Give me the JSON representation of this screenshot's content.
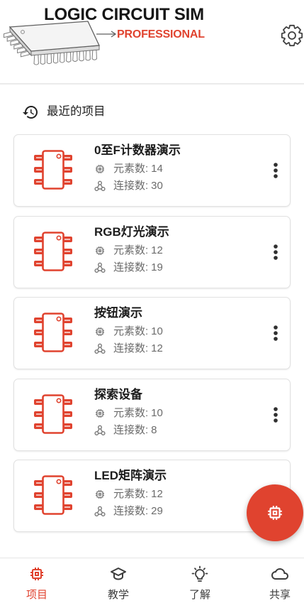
{
  "header": {
    "logo_title": "LOGIC CIRCUIT SIM",
    "logo_subtitle": "PROFESSIONAL",
    "settings_icon": "gear-icon"
  },
  "recent": {
    "icon": "history-icon",
    "heading": "最近的项目"
  },
  "labels": {
    "elements": "元素数:",
    "connections": "连接数:"
  },
  "projects": [
    {
      "title": "0至F计数器演示",
      "elements": 14,
      "connections": 30
    },
    {
      "title": "RGB灯光演示",
      "elements": 12,
      "connections": 19
    },
    {
      "title": "按钮演示",
      "elements": 10,
      "connections": 12
    },
    {
      "title": "探索设备",
      "elements": 10,
      "connections": 8
    },
    {
      "title": "LED矩阵演示",
      "elements": 12,
      "connections": 29
    }
  ],
  "project_icons": {
    "thumbnail": "chip-icon",
    "elements": "memory-icon",
    "connections": "connection-icon",
    "menu": "more-vert-icon"
  },
  "fab": {
    "icon": "memory-icon"
  },
  "bottom_nav": [
    {
      "label": "项目",
      "icon": "memory-icon",
      "active": true
    },
    {
      "label": "教学",
      "icon": "graduation-cap-icon",
      "active": false
    },
    {
      "label": "了解",
      "icon": "lightbulb-icon",
      "active": false
    },
    {
      "label": "共享",
      "icon": "cloud-icon",
      "active": false
    }
  ],
  "colors": {
    "accent": "#e0432f",
    "text": "#212121",
    "muted": "#6b6b6b",
    "divider": "#e6e6e6"
  }
}
